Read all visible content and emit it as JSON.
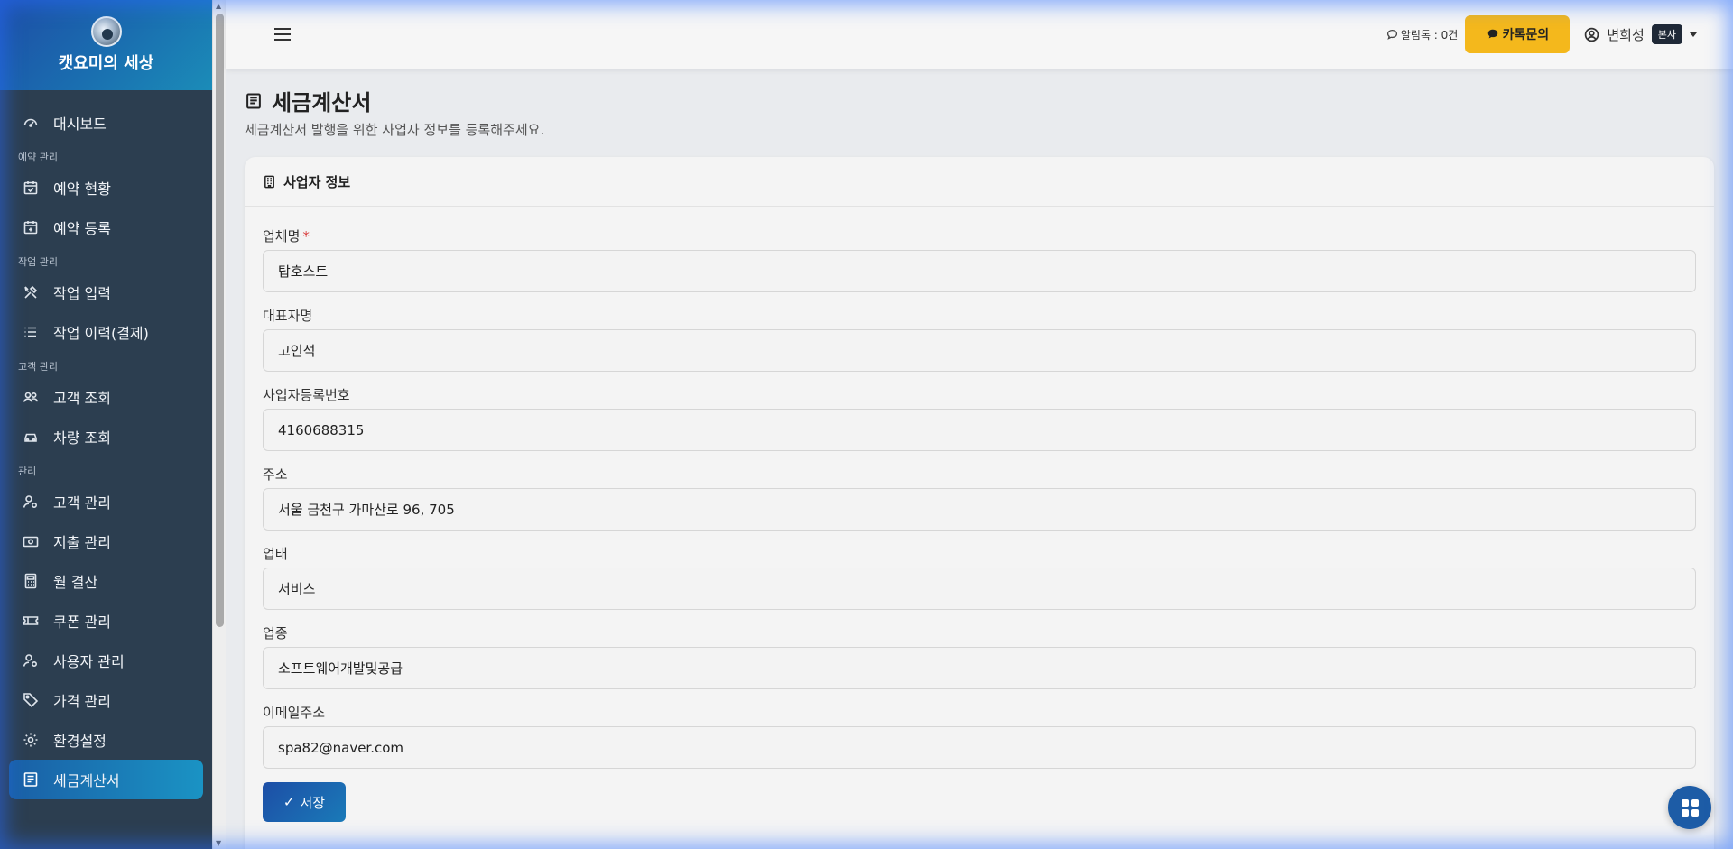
{
  "brand": {
    "name": "캣요미의 세상"
  },
  "sidebar": {
    "items": [
      {
        "type": "item",
        "label": "대시보드",
        "icon": "gauge-icon"
      },
      {
        "type": "section",
        "label": "예약 관리"
      },
      {
        "type": "item",
        "label": "예약 현황",
        "icon": "calendar-check-icon"
      },
      {
        "type": "item",
        "label": "예약 등록",
        "icon": "calendar-plus-icon"
      },
      {
        "type": "section",
        "label": "작업 관리"
      },
      {
        "type": "item",
        "label": "작업 입력",
        "icon": "tools-icon"
      },
      {
        "type": "item",
        "label": "작업 이력(결제)",
        "icon": "list-icon"
      },
      {
        "type": "section",
        "label": "고객 관리"
      },
      {
        "type": "item",
        "label": "고객 조회",
        "icon": "people-icon"
      },
      {
        "type": "item",
        "label": "차량 조회",
        "icon": "car-icon"
      },
      {
        "type": "section",
        "label": "관리"
      },
      {
        "type": "item",
        "label": "고객 관리",
        "icon": "person-gear-icon"
      },
      {
        "type": "item",
        "label": "지출 관리",
        "icon": "cash-icon"
      },
      {
        "type": "item",
        "label": "월 결산",
        "icon": "calculator-icon"
      },
      {
        "type": "item",
        "label": "쿠폰 관리",
        "icon": "ticket-icon"
      },
      {
        "type": "item",
        "label": "사용자 관리",
        "icon": "person-gear-icon"
      },
      {
        "type": "item",
        "label": "가격 관리",
        "icon": "tag-icon"
      },
      {
        "type": "item",
        "label": "환경설정",
        "icon": "gear-icon"
      },
      {
        "type": "item",
        "label": "세금계산서",
        "icon": "receipt-icon",
        "active": true
      }
    ]
  },
  "topbar": {
    "kakao_count": "알림톡 : 0건",
    "kakao_button": "카톡문의",
    "user_name": "변희성",
    "user_badge": "본사"
  },
  "page": {
    "title": "세금계산서",
    "subtitle": "세금계산서 발행을 위한 사업자 정보를 등록해주세요."
  },
  "card": {
    "title": "사업자 정보",
    "fields": [
      {
        "label": "업체명",
        "value": "탑호스트",
        "required": true
      },
      {
        "label": "대표자명",
        "value": "고인석"
      },
      {
        "label": "사업자등록번호",
        "value": "4160688315"
      },
      {
        "label": "주소",
        "value": "서울 금천구 가마산로 96, 705"
      },
      {
        "label": "업태",
        "value": "서비스"
      },
      {
        "label": "업종",
        "value": "소프트웨어개발및공급"
      },
      {
        "label": "이메일주소",
        "value": "spa82@naver.com"
      }
    ],
    "save_label": "저장"
  },
  "colors": {
    "sidebar_bg": "#2c3e50",
    "accent": "#1a6fb0",
    "kakao": "#f4b81c"
  }
}
